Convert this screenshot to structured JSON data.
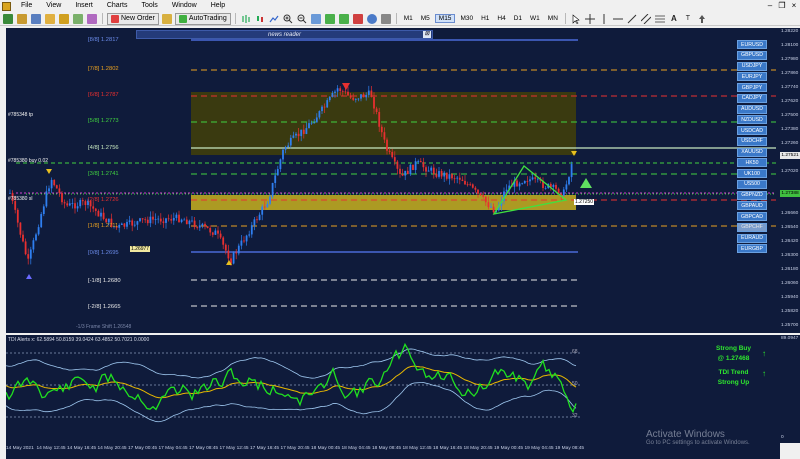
{
  "menubar": {
    "items": [
      "File",
      "View",
      "Insert",
      "Charts",
      "Tools",
      "Window",
      "Help"
    ]
  },
  "toolbar": {
    "new_order_label": "New Order",
    "autotrading_label": "AutoTrading",
    "timeframes": [
      "M1",
      "M5",
      "M15",
      "M30",
      "H1",
      "H4",
      "D1",
      "W1",
      "MN"
    ],
    "active_timeframe": "M15"
  },
  "chart": {
    "news_reader": "news reader",
    "fib_levels": [
      {
        "label": "[8/8]",
        "value": "1.2817",
        "color": "#4a6ad8"
      },
      {
        "label": "[7/8]",
        "value": "1.2802",
        "color": "#e8a020"
      },
      {
        "label": "[6/8]",
        "value": "1.2787",
        "color": "#e83030"
      },
      {
        "label": "[5/8]",
        "value": "1.2773",
        "color": "#40d040"
      },
      {
        "label": "[4/8]",
        "value": "1.2756",
        "color": "#c8e8c0"
      },
      {
        "label": "[3/8]",
        "value": "1.2741",
        "color": "#40d040"
      },
      {
        "label": "[2/8]",
        "value": "1.2726",
        "color": "#e83030"
      },
      {
        "label": "[1/8]",
        "value": "1.2711",
        "color": "#e8a020"
      },
      {
        "label": "[0/8]",
        "value": "1.2695",
        "color": "#4a6ad8"
      },
      {
        "label": "[-1/8]",
        "value": "1.2680",
        "color": "#ffffff"
      },
      {
        "label": "[-2/8]",
        "value": "1.2665",
        "color": "#ffffff"
      }
    ],
    "annotations": {
      "tp": "#785348 tp",
      "buy": "#785380 buy 0.02",
      "sl": "#785380 sl",
      "frame": "-1/3 Frame Shift  1.26548",
      "low_tag": "1.26977",
      "current_tag": "1.27250"
    },
    "price_ticks": [
      "1.28220",
      "1.28100",
      "1.27980",
      "1.27860",
      "1.27740",
      "1.27620",
      "1.27500",
      "1.27380",
      "1.27260",
      "1.27140",
      "1.27020",
      "1.26900",
      "1.26780",
      "1.26660",
      "1.26540",
      "1.26420",
      "1.26300",
      "1.26180",
      "1.26060",
      "1.25940",
      "1.25820",
      "1.25700"
    ],
    "price_tags": [
      {
        "value": "1.27521",
        "bg": "#e8e8e8",
        "fg": "#000000"
      },
      {
        "value": "1.27388",
        "bg": "#40c040",
        "fg": "#000000"
      }
    ],
    "symbols": [
      "EURUSD",
      "GBPUSD",
      "USDJPY",
      "EURJPY",
      "GBPJPY",
      "CADJPY",
      "AUDUSD",
      "NZDUSD",
      "USDCAD",
      "USDCHF",
      "XAUUSD",
      "HK50",
      "UK100",
      "US500",
      "GBPNZD",
      "GBPAUD",
      "GBPCAD",
      "GBPCHF",
      "EURAUD",
      "EURGBP"
    ],
    "selected_symbol": "GBPCHF"
  },
  "indicator": {
    "title": "TDI Alerts  x: 62.5894  50.8159  39.0424  63.4852  50.7021  0.0000",
    "signal_buy": "Strong Buy",
    "signal_at": "@ 1.27468",
    "signal_trend_1": "TDI Trend",
    "signal_trend_2": "Strong Up",
    "level_68": "68",
    "level_50": "50",
    "level_32": "32",
    "axis_top": "89.0947",
    "axis_bottom": "0"
  },
  "time_axis": [
    "14 May 2021",
    "14 May 12:45",
    "14 May 16:45",
    "14 May 20:45",
    "17 May 00:45",
    "17 May 04:45",
    "17 May 08:45",
    "17 May 12:45",
    "17 May 16:45",
    "17 May 20:45",
    "18 May 00:45",
    "18 May 04:45",
    "18 May 08:45",
    "18 May 12:45",
    "18 May 16:45",
    "18 May 20:45",
    "19 May 00:45",
    "19 May 04:45",
    "19 May 08:45"
  ],
  "watermark": {
    "line1": "Activate Windows",
    "line2": "Go to PC settings to activate Windows."
  },
  "colors": {
    "chart_bg": "#0f1b3b",
    "bull": "#2f7ff0",
    "bear": "#e83030",
    "rsi": "#20e020",
    "signal": "#e8b800",
    "band": "#9fc8f0"
  }
}
